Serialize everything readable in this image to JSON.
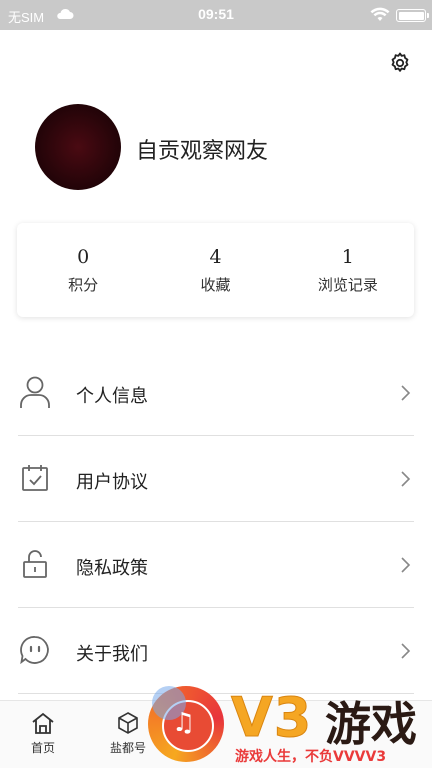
{
  "status_bar": {
    "carrier": "无SIM",
    "time": "09:51"
  },
  "profile": {
    "nickname": "自贡观察网友"
  },
  "stats": [
    {
      "value": "0",
      "label": "积分"
    },
    {
      "value": "4",
      "label": "收藏"
    },
    {
      "value": "1",
      "label": "浏览记录"
    }
  ],
  "menu": [
    {
      "label": "个人信息",
      "icon": "person-icon"
    },
    {
      "label": "用户协议",
      "icon": "calendar-check-icon"
    },
    {
      "label": "隐私政策",
      "icon": "unlock-icon"
    },
    {
      "label": "关于我们",
      "icon": "chat-face-icon"
    }
  ],
  "bottom_nav": [
    {
      "label": "首页",
      "icon": "home-icon"
    },
    {
      "label": "盐都号",
      "icon": "cube-icon"
    }
  ],
  "watermark": {
    "brand": "V3",
    "game": "游戏",
    "slogan": "游戏人生，不负VVVV3"
  }
}
